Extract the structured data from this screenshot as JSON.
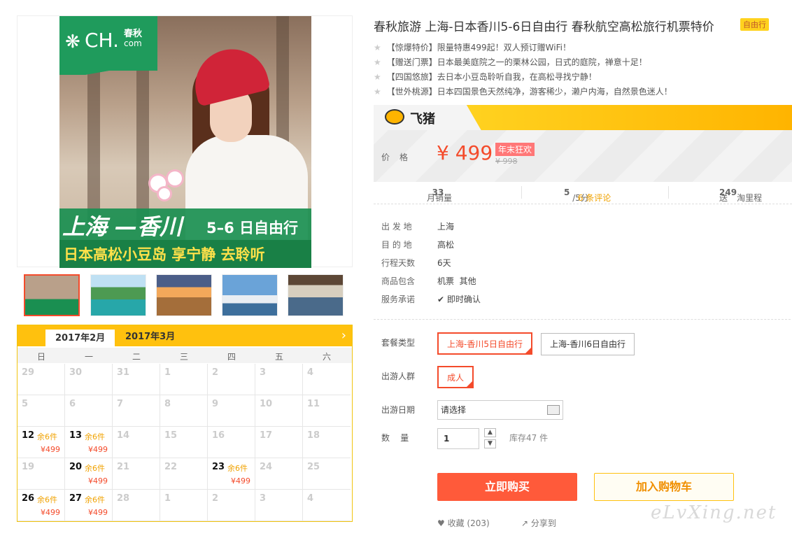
{
  "gallery": {
    "logo_brand": "CH.",
    "logo_cn": "春秋",
    "logo_domain": "com",
    "banner_line1": "上海 —香川",
    "banner_days": "5–6 日自由行",
    "banner_line2": "日本高松小豆岛 享宁静 去聆听"
  },
  "calendar": {
    "tabs": [
      "2017年2月",
      "2017年3月"
    ],
    "weekdays": [
      "日",
      "一",
      "二",
      "三",
      "四",
      "五",
      "六"
    ],
    "rows": [
      [
        {
          "d": "29"
        },
        {
          "d": "30"
        },
        {
          "d": "31"
        },
        {
          "d": "1"
        },
        {
          "d": "2"
        },
        {
          "d": "3"
        },
        {
          "d": "4"
        }
      ],
      [
        {
          "d": "5"
        },
        {
          "d": "6"
        },
        {
          "d": "7"
        },
        {
          "d": "8"
        },
        {
          "d": "9"
        },
        {
          "d": "10"
        },
        {
          "d": "11"
        }
      ],
      [
        {
          "d": "12",
          "s": "余6件",
          "p": "¥499"
        },
        {
          "d": "13",
          "s": "余6件",
          "p": "¥499"
        },
        {
          "d": "14"
        },
        {
          "d": "15"
        },
        {
          "d": "16"
        },
        {
          "d": "17"
        },
        {
          "d": "18"
        }
      ],
      [
        {
          "d": "19"
        },
        {
          "d": "20",
          "s": "余6件",
          "p": "¥499"
        },
        {
          "d": "21"
        },
        {
          "d": "22"
        },
        {
          "d": "23",
          "s": "余6件",
          "p": "¥499"
        },
        {
          "d": "24"
        },
        {
          "d": "25"
        }
      ],
      [
        {
          "d": "26",
          "s": "余6件",
          "p": "¥499"
        },
        {
          "d": "27",
          "s": "余6件",
          "p": "¥499"
        },
        {
          "d": "28"
        },
        {
          "d": "1"
        },
        {
          "d": "2"
        },
        {
          "d": "3"
        },
        {
          "d": "4"
        }
      ]
    ]
  },
  "product": {
    "title": "春秋旅游 上海-日本香川5-6日自由行 春秋航空高松旅行机票特价",
    "tag": "自由行",
    "highlights": [
      "【惊爆特价】限量特惠499起！双人预订赠WiFi！",
      "【赠送门票】日本最美庭院之一的栗林公园，日式的庭院，禅意十足！",
      "【四国悠旅】去日本小豆岛聆听自我，在高松寻找宁静！",
      "【世外桃源】日本四国景色天然纯净，游客稀少，濑户内海，自然景色迷人！"
    ],
    "platform": "飞猪",
    "price_label": "价格",
    "price": "¥ 499",
    "promo": "年末狂欢",
    "old_price": "¥ 998",
    "monthly_sales_label": "月销量",
    "monthly_sales": "33",
    "rating": "5",
    "rating_suffix": "/5分",
    "reviews": "6 条评论",
    "points_prefix": "送",
    "points": "249",
    "points_suffix": "淘里程"
  },
  "info": [
    {
      "k": "出 发 地",
      "v": "上海"
    },
    {
      "k": "目 的 地",
      "v": "高松"
    },
    {
      "k": "行程天数",
      "v": "6天"
    },
    {
      "k": "商品包含",
      "v": "机票  其他"
    },
    {
      "k": "服务承诺",
      "v": "即时确认"
    }
  ],
  "options": {
    "package_label": "套餐类型",
    "packages": [
      "上海-香川5日自由行",
      "上海-香川6日自由行"
    ],
    "crowd_label": "出游人群",
    "crowd": "成人",
    "date_label": "出游日期",
    "date_placeholder": "请选择",
    "qty_label": "数    量",
    "qty": "1",
    "stock": "库存47 件"
  },
  "actions": {
    "buy": "立即购买",
    "cart": "加入购物车",
    "fav": "收藏 (203)",
    "share": "分享到"
  },
  "watermark": "eLvXing.net"
}
